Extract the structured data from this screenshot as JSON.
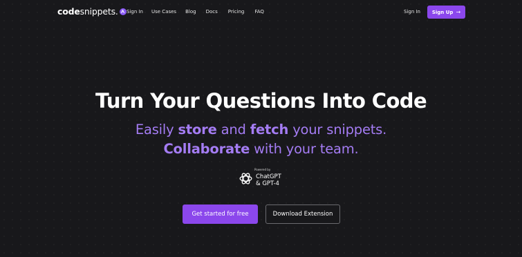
{
  "nav": {
    "logo": {
      "prefix": "code",
      "suffix": "snippets.",
      "badge_icon": "sparkle-icon"
    },
    "links": [
      {
        "label": "Sign In"
      },
      {
        "label": "Use Cases"
      },
      {
        "label": "Blog"
      },
      {
        "label": "Docs"
      },
      {
        "label": "Pricing"
      },
      {
        "label": "FAQ"
      }
    ],
    "sign_in": "Sign In",
    "sign_up": {
      "label": "Sign Up",
      "icon": "arrow-right-icon",
      "arrow": "→"
    }
  },
  "hero": {
    "title": "Turn Your Questions Into Code",
    "line1": {
      "store": "store",
      "fetch": "fetch",
      "p1": "Easily ",
      "p2": " and ",
      "p3": " your snippets."
    },
    "line2": {
      "collaborate": "Collaborate",
      "rest": " with your team."
    },
    "powered": {
      "label": "Powered by",
      "name": "ChatGPT",
      "model": "& GPT-4",
      "icon": "openai-icon"
    },
    "cta_primary": "Get started for free",
    "cta_secondary": "Download Extension"
  },
  "colors": {
    "background": "#18181b",
    "accent": "#8b47ec",
    "accent_text": "#a47cf3"
  }
}
